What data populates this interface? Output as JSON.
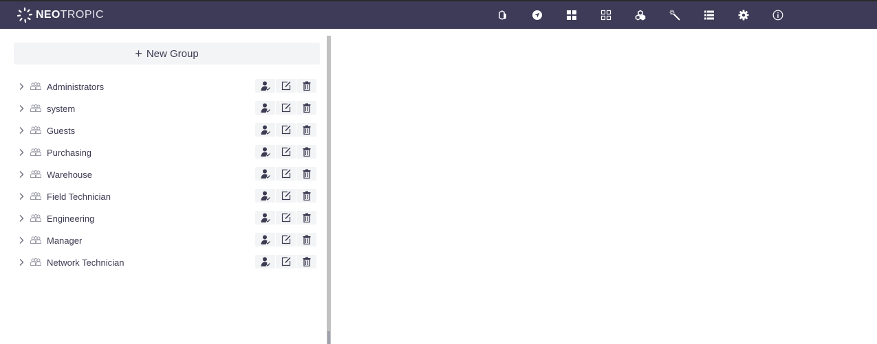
{
  "header": {
    "brand_bold": "NEO",
    "brand_light": "TROPIC",
    "nav_items": [
      {
        "name": "inventory",
        "icon": "boxes-icon"
      },
      {
        "name": "navigate",
        "icon": "compass-icon"
      },
      {
        "name": "dashboard",
        "icon": "grid-filled-icon"
      },
      {
        "name": "apps",
        "icon": "grid-outline-icon"
      },
      {
        "name": "modules",
        "icon": "cubes-icon"
      },
      {
        "name": "wizard",
        "icon": "magic-wand-icon"
      },
      {
        "name": "list",
        "icon": "list-icon"
      },
      {
        "name": "settings",
        "icon": "gear-icon"
      },
      {
        "name": "about",
        "icon": "info-icon"
      }
    ]
  },
  "sidebar": {
    "new_group_label": "New Group",
    "groups": [
      {
        "name": "Administrators"
      },
      {
        "name": "system"
      },
      {
        "name": "Guests"
      },
      {
        "name": "Purchasing"
      },
      {
        "name": "Warehouse"
      },
      {
        "name": "Field Technician"
      },
      {
        "name": "Engineering"
      },
      {
        "name": "Manager"
      },
      {
        "name": "Network Technician"
      }
    ]
  },
  "colors": {
    "header_bg": "#3d3b57",
    "text": "#3c3b52",
    "button_bg": "#f3f4f6"
  }
}
